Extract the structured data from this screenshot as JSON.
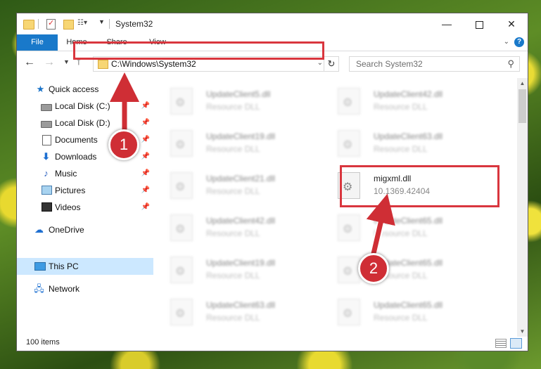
{
  "window": {
    "title": "System32",
    "controls": {
      "minimize": "—",
      "maximize": "",
      "close": "✕"
    }
  },
  "ribbon": {
    "tabs": [
      {
        "label": "File"
      },
      {
        "label": "Home"
      },
      {
        "label": "Share"
      },
      {
        "label": "View"
      }
    ],
    "help": "?"
  },
  "nav": {
    "address": "C:\\Windows\\System32",
    "search_placeholder": "Search System32"
  },
  "sidebar": {
    "items": [
      {
        "label": "Quick access",
        "icon": "star-icon"
      },
      {
        "label": "Local Disk (C:)",
        "icon": "disk-icon",
        "pinned": true
      },
      {
        "label": "Local Disk (D:)",
        "icon": "disk-icon",
        "pinned": true
      },
      {
        "label": "Documents",
        "icon": "documents-icon",
        "pinned": true
      },
      {
        "label": "Downloads",
        "icon": "download-icon",
        "pinned": true
      },
      {
        "label": "Music",
        "icon": "music-icon",
        "pinned": true
      },
      {
        "label": "Pictures",
        "icon": "pictures-icon",
        "pinned": true
      },
      {
        "label": "Videos",
        "icon": "videos-icon",
        "pinned": true
      },
      {
        "label": "OneDrive",
        "icon": "cloud-icon"
      },
      {
        "label": "This PC",
        "icon": "pc-icon",
        "selected": true
      },
      {
        "label": "Network",
        "icon": "network-icon"
      }
    ]
  },
  "files": [
    {
      "name": "UpdateClient5.dll",
      "desc": "Resource DLL",
      "blurred": true
    },
    {
      "name": "UpdateClient42.dll",
      "desc": "Resource DLL",
      "blurred": true
    },
    {
      "name": "UpdateClient19.dll",
      "desc": "Resource DLL",
      "blurred": true
    },
    {
      "name": "UpdateClient63.dll",
      "desc": "Resource DLL",
      "blurred": true
    },
    {
      "name": "UpdateClient21.dll",
      "desc": "Resource DLL",
      "blurred": true
    },
    {
      "name": "migxml.dll",
      "desc": "10.1369.42404",
      "blurred": false
    },
    {
      "name": "UpdateClient42.dll",
      "desc": "Resource DLL",
      "blurred": true
    },
    {
      "name": "UpdateClient65.dll",
      "desc": "Resource DLL",
      "blurred": true
    },
    {
      "name": "UpdateClient19.dll",
      "desc": "Resource DLL",
      "blurred": true
    },
    {
      "name": "UpdateClient65.dll",
      "desc": "Resource DLL",
      "blurred": true
    },
    {
      "name": "UpdateClient63.dll",
      "desc": "Resource DLL",
      "blurred": true
    },
    {
      "name": "UpdateClient65.dll",
      "desc": "Resource DLL",
      "blurred": true
    }
  ],
  "status": {
    "item_count": "100 items"
  },
  "callouts": [
    {
      "label": "1"
    },
    {
      "label": "2"
    }
  ],
  "colors": {
    "accent": "#1979ca",
    "highlight": "#d9363e",
    "callout": "#cf2e35",
    "selected": "#cce8ff"
  }
}
